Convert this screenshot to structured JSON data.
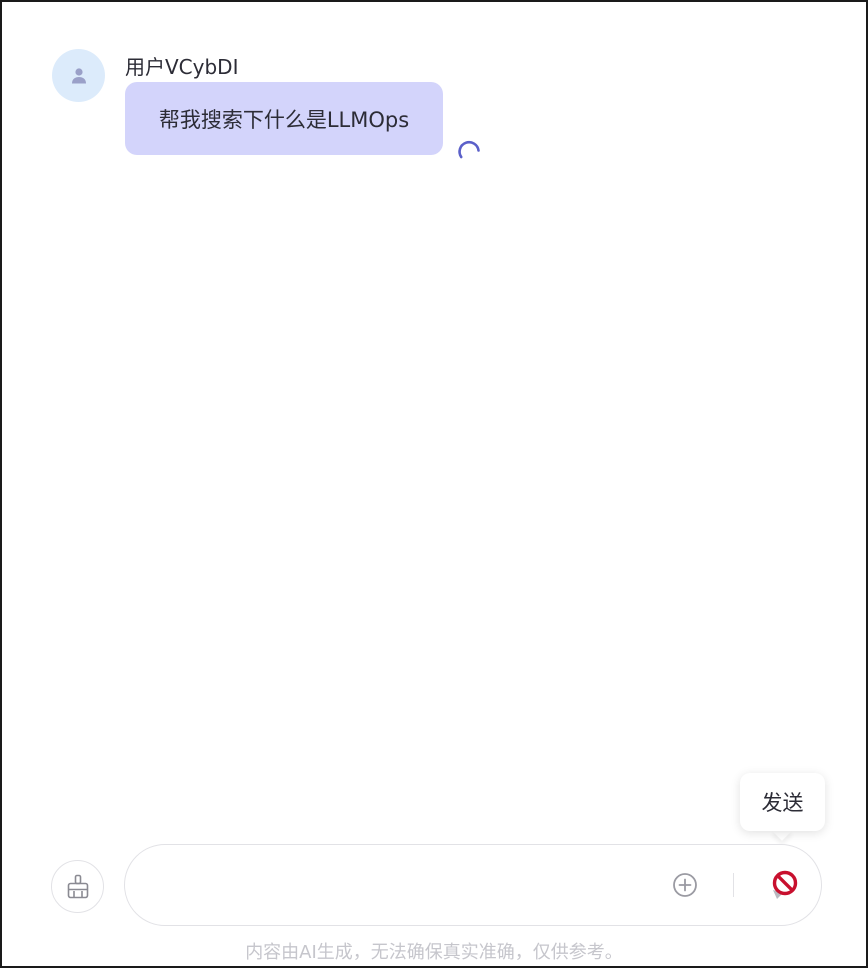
{
  "message": {
    "user_name": "用户VCybDI",
    "text": "帮我搜索下什么是LLMOps",
    "avatar_icon": "user-icon",
    "status": "loading"
  },
  "tooltip": {
    "label": "发送"
  },
  "composer": {
    "input_value": "",
    "placeholder": "",
    "clear_icon": "broom-icon",
    "attach_icon": "plus-circle-icon",
    "send_icon": "send-icon",
    "send_state_icon": "not-allowed-icon"
  },
  "footer": {
    "disclaimer": "内容由AI生成，无法确保真实准确，仅供参考。"
  },
  "colors": {
    "avatar_bg": "#dcebfb",
    "bubble_bg": "#d3d4fb",
    "spinner": "#5b60c9",
    "not_allowed_red": "#c8102e"
  }
}
